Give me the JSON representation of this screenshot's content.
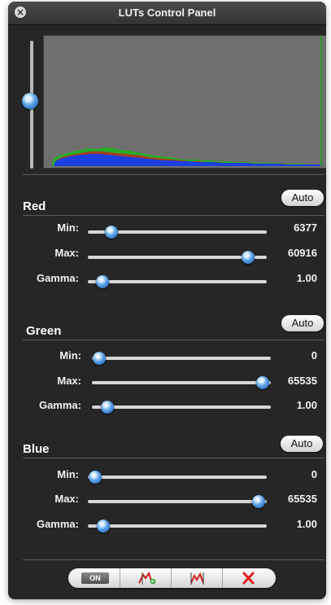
{
  "window": {
    "title": "LUTs Control Panel"
  },
  "channels": [
    {
      "name": "Red",
      "auto_label": "Auto",
      "rows": [
        {
          "label": "Min:",
          "value": "6377",
          "level": 0.097
        },
        {
          "label": "Max:",
          "value": "60916",
          "level": 0.93
        },
        {
          "label": "Gamma:",
          "value": "1.00",
          "level": 0.05
        }
      ]
    },
    {
      "name": "Green",
      "auto_label": "Auto",
      "rows": [
        {
          "label": "Min:",
          "value": "0",
          "level": 0.0
        },
        {
          "label": "Max:",
          "value": "65535",
          "level": 1.0
        },
        {
          "label": "Gamma:",
          "value": "1.00",
          "level": 0.05
        }
      ]
    },
    {
      "name": "Blue",
      "auto_label": "Auto",
      "rows": [
        {
          "label": "Min:",
          "value": "0",
          "level": 0.0
        },
        {
          "label": "Max:",
          "value": "65535",
          "level": 1.0
        },
        {
          "label": "Gamma:",
          "value": "1.00",
          "level": 0.05
        }
      ]
    }
  ],
  "toolbar": {
    "toggle_label": "ON",
    "buttons": [
      "on-toggle",
      "apply-curve-icon",
      "curve-icon",
      "delete-icon"
    ]
  },
  "colors": {
    "panel_bg": "#262626",
    "histogram_bg": "#6f6f6f",
    "histogram_red": "#d01a1a",
    "histogram_green": "#1cb71c",
    "histogram_blue": "#1c3fe0",
    "delete": "#e01f1f"
  },
  "vertical_slider_level": 0.58
}
